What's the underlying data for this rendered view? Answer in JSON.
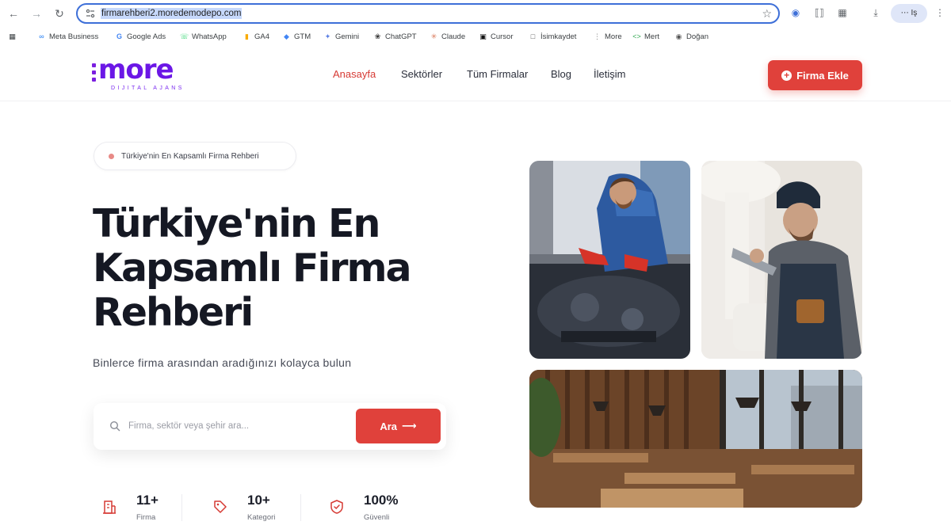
{
  "browser": {
    "url": "firmarehberi2.moredemodepo.com",
    "profile_label": "⋯ Iş",
    "bookmarks": [
      {
        "label": "Meta Business",
        "icon": "meta-icon"
      },
      {
        "label": "Google Ads",
        "icon": "google-icon"
      },
      {
        "label": "WhatsApp",
        "icon": "whatsapp-icon"
      },
      {
        "label": "GA4",
        "icon": "analytics-icon"
      },
      {
        "label": "GTM",
        "icon": "gtm-icon"
      },
      {
        "label": "Gemini",
        "icon": "gemini-icon"
      },
      {
        "label": "ChatGPT",
        "icon": "chatgpt-icon"
      },
      {
        "label": "Claude",
        "icon": "claude-icon"
      },
      {
        "label": "Cursor",
        "icon": "cursor-icon"
      },
      {
        "label": "İsimkaydet",
        "icon": "page-icon"
      },
      {
        "label": "More",
        "icon": "more-icon"
      },
      {
        "label": "Mert",
        "icon": "code-icon"
      },
      {
        "label": "Doğan",
        "icon": "globe-icon"
      }
    ]
  },
  "site": {
    "logo_text": "more",
    "logo_sub": "DIJITAL AJANS",
    "nav": [
      {
        "label": "Anasayfa",
        "active": true
      },
      {
        "label": "Sektörler",
        "active": false
      },
      {
        "label": "Tüm Firmalar",
        "active": false
      },
      {
        "label": "Blog",
        "active": false
      },
      {
        "label": "İletişim",
        "active": false
      }
    ],
    "cta_label": "Firma Ekle"
  },
  "hero": {
    "badge": "Türkiye'nin En Kapsamlı Firma Rehberi",
    "title_lines": [
      "Türkiye'nin En",
      "Kapsamlı Firma",
      "Rehberi"
    ],
    "subtitle": "Binlerce firma arasından aradığınızı kolayca bulun",
    "search_placeholder": "Firma, sektör veya şehir ara...",
    "search_button": "Ara",
    "stats": [
      {
        "value": "11+",
        "label": "Firma",
        "icon": "building-icon"
      },
      {
        "value": "10+",
        "label": "Kategori",
        "icon": "tag-icon"
      },
      {
        "value": "100%",
        "label": "Güvenli",
        "icon": "shield-check-icon"
      }
    ]
  },
  "gallery": [
    {
      "name": "mechanic-photo"
    },
    {
      "name": "plumber-photo"
    },
    {
      "name": "restaurant-photo"
    }
  ],
  "colors": {
    "accent": "#e0413b",
    "brand_purple": "#6b17e6",
    "active_nav": "#d63a34"
  }
}
